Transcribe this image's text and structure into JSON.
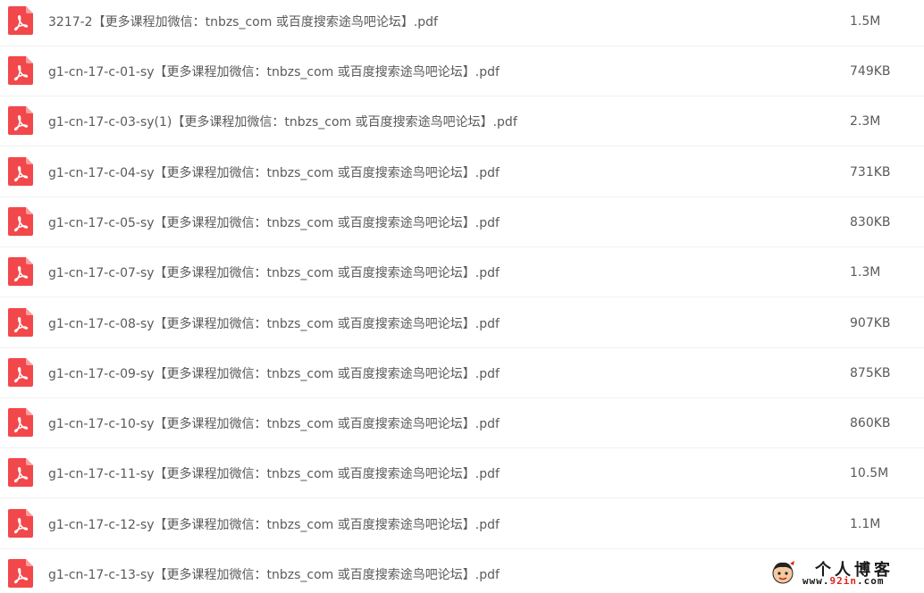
{
  "colors": {
    "pdf_icon": "#f2484b",
    "text": "#5a5a5a",
    "row_divider": "#f1f2f4",
    "watermark_accent": "#e0241b"
  },
  "files": [
    {
      "name": "3217-2【更多课程加微信：tnbzs_com 或百度搜索途鸟吧论坛】.pdf",
      "size": "1.5M",
      "icon": "pdf-icon"
    },
    {
      "name": "g1-cn-17-c-01-sy【更多课程加微信：tnbzs_com 或百度搜索途鸟吧论坛】.pdf",
      "size": "749KB",
      "icon": "pdf-icon"
    },
    {
      "name": "g1-cn-17-c-03-sy(1)【更多课程加微信：tnbzs_com 或百度搜索途鸟吧论坛】.pdf",
      "size": "2.3M",
      "icon": "pdf-icon"
    },
    {
      "name": "g1-cn-17-c-04-sy【更多课程加微信：tnbzs_com 或百度搜索途鸟吧论坛】.pdf",
      "size": "731KB",
      "icon": "pdf-icon"
    },
    {
      "name": "g1-cn-17-c-05-sy【更多课程加微信：tnbzs_com 或百度搜索途鸟吧论坛】.pdf",
      "size": "830KB",
      "icon": "pdf-icon"
    },
    {
      "name": "g1-cn-17-c-07-sy【更多课程加微信：tnbzs_com 或百度搜索途鸟吧论坛】.pdf",
      "size": "1.3M",
      "icon": "pdf-icon"
    },
    {
      "name": "g1-cn-17-c-08-sy【更多课程加微信：tnbzs_com 或百度搜索途鸟吧论坛】.pdf",
      "size": "907KB",
      "icon": "pdf-icon"
    },
    {
      "name": "g1-cn-17-c-09-sy【更多课程加微信：tnbzs_com 或百度搜索途鸟吧论坛】.pdf",
      "size": "875KB",
      "icon": "pdf-icon"
    },
    {
      "name": "g1-cn-17-c-10-sy【更多课程加微信：tnbzs_com 或百度搜索途鸟吧论坛】.pdf",
      "size": "860KB",
      "icon": "pdf-icon"
    },
    {
      "name": "g1-cn-17-c-11-sy【更多课程加微信：tnbzs_com 或百度搜索途鸟吧论坛】.pdf",
      "size": "10.5M",
      "icon": "pdf-icon"
    },
    {
      "name": "g1-cn-17-c-12-sy【更多课程加微信：tnbzs_com 或百度搜索途鸟吧论坛】.pdf",
      "size": "1.1M",
      "icon": "pdf-icon"
    },
    {
      "name": "g1-cn-17-c-13-sy【更多课程加微信：tnbzs_com 或百度搜索途鸟吧论坛】.pdf",
      "size": "",
      "icon": "pdf-icon"
    }
  ],
  "watermark": {
    "title": "个人博客",
    "url_prefix": "www.",
    "url_highlight": "92in",
    "url_suffix": ".com"
  }
}
